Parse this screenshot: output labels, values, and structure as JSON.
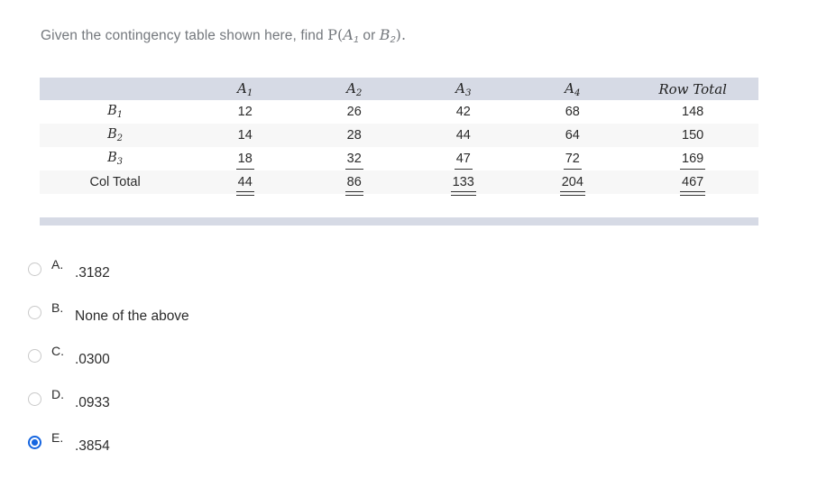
{
  "question": {
    "lead": "Given the contingency table shown here, find ",
    "prob_open": "P(",
    "var_a": "A",
    "sub_a": "1",
    "conj": " or ",
    "var_b": "B",
    "sub_b": "2",
    "prob_close": ")."
  },
  "table": {
    "corner_header": "",
    "column_headers": [
      "A₁",
      "A₂",
      "A₃",
      "A₄",
      "Row Total"
    ],
    "column_header_parts": [
      {
        "base": "A",
        "sub": "1",
        "italic": true
      },
      {
        "base": "A",
        "sub": "2",
        "italic": true
      },
      {
        "base": "A",
        "sub": "3",
        "italic": true
      },
      {
        "base": "A",
        "sub": "4",
        "italic": true
      },
      {
        "base": "Row Total",
        "sub": "",
        "italic": true
      }
    ],
    "rows": [
      {
        "label_base": "B",
        "label_sub": "1",
        "label_italic": true,
        "values": [
          "12",
          "26",
          "42",
          "68",
          "148"
        ],
        "rule": "none",
        "stripe": false
      },
      {
        "label_base": "B",
        "label_sub": "2",
        "label_italic": true,
        "values": [
          "14",
          "28",
          "44",
          "64",
          "150"
        ],
        "rule": "none",
        "stripe": true
      },
      {
        "label_base": "B",
        "label_sub": "3",
        "label_italic": true,
        "values": [
          "18",
          "32",
          "47",
          "72",
          "169"
        ],
        "rule": "single",
        "stripe": false
      },
      {
        "label_base": "Col Total",
        "label_sub": "",
        "label_italic": false,
        "values": [
          "44",
          "86",
          "133",
          "204",
          "467"
        ],
        "rule": "double",
        "stripe": true
      }
    ]
  },
  "options": [
    {
      "letter": "A.",
      "value": ".3182",
      "selected": false
    },
    {
      "letter": "B.",
      "value": "None of the above",
      "selected": false
    },
    {
      "letter": "C.",
      "value": ".0300",
      "selected": false
    },
    {
      "letter": "D.",
      "value": ".0933",
      "selected": false
    },
    {
      "letter": "E.",
      "value": ".3854",
      "selected": true
    }
  ],
  "colors": {
    "header_band": "#d6dae5",
    "stripe_row": "#f7f7f7",
    "question_text": "#74787d",
    "accent_selected": "#1565e0",
    "radio_outline": "#c9c9c9"
  }
}
